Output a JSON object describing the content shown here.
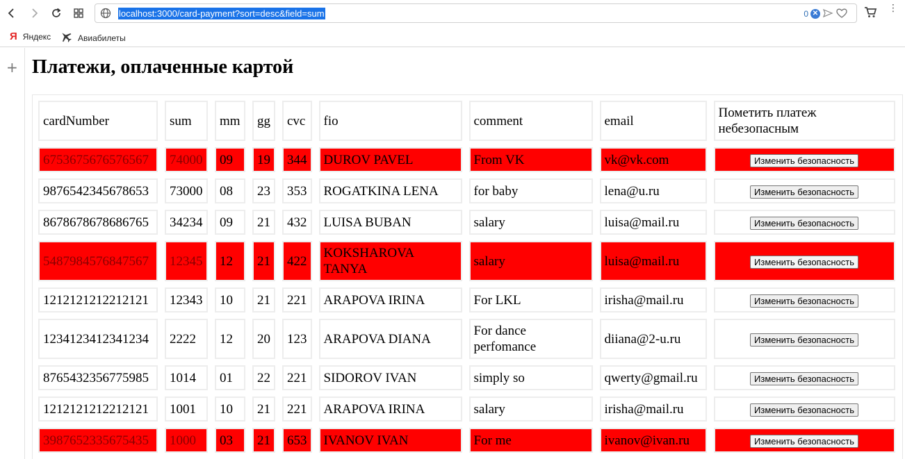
{
  "browser": {
    "url": "localhost:3000/card-payment?sort=desc&field=sum",
    "adblock_count": "0",
    "bookmarks": [
      {
        "label": "Яндекс"
      },
      {
        "label": "Авиабилеты"
      }
    ]
  },
  "page": {
    "title": "Платежи, оплаченные картой"
  },
  "table": {
    "headers": [
      "cardNumber",
      "sum",
      "mm",
      "gg",
      "cvc",
      "fio",
      "comment",
      "email",
      "Пометить платеж небезопасным"
    ],
    "button_label": "Изменить безопасность",
    "rows": [
      {
        "cardNumber": "6753675676576567",
        "sum": "74000",
        "mm": "09",
        "gg": "19",
        "cvc": "344",
        "fio": "DUROV PAVEL",
        "comment": "From VK",
        "email": "vk@vk.com",
        "unsafe": true
      },
      {
        "cardNumber": "9876542345678653",
        "sum": "73000",
        "mm": "08",
        "gg": "23",
        "cvc": "353",
        "fio": "ROGATKINA LENA",
        "comment": "for baby",
        "email": "lena@u.ru",
        "unsafe": false
      },
      {
        "cardNumber": "8678678678686765",
        "sum": "34234",
        "mm": "09",
        "gg": "21",
        "cvc": "432",
        "fio": "LUISA BUBAN",
        "comment": "salary",
        "email": "luisa@mail.ru",
        "unsafe": false
      },
      {
        "cardNumber": "5487984576847567",
        "sum": "12345",
        "mm": "12",
        "gg": "21",
        "cvc": "422",
        "fio": "KOKSHAROVA TANYA",
        "comment": "salary",
        "email": "luisa@mail.ru",
        "unsafe": true
      },
      {
        "cardNumber": "1212121212212121",
        "sum": "12343",
        "mm": "10",
        "gg": "21",
        "cvc": "221",
        "fio": "ARAPOVA IRINA",
        "comment": "For LKL",
        "email": "irisha@mail.ru",
        "unsafe": false
      },
      {
        "cardNumber": "1234123412341234",
        "sum": "2222",
        "mm": "12",
        "gg": "20",
        "cvc": "123",
        "fio": "ARAPOVA DIANA",
        "comment": "For dance perfomance",
        "email": "diiana@2-u.ru",
        "unsafe": false
      },
      {
        "cardNumber": "8765432356775985",
        "sum": "1014",
        "mm": "01",
        "gg": "22",
        "cvc": "221",
        "fio": "SIDOROV IVAN",
        "comment": "simply so",
        "email": "qwerty@gmail.ru",
        "unsafe": false
      },
      {
        "cardNumber": "1212121212212121",
        "sum": "1001",
        "mm": "10",
        "gg": "21",
        "cvc": "221",
        "fio": "ARAPOVA IRINA",
        "comment": "salary",
        "email": "irisha@mail.ru",
        "unsafe": false
      },
      {
        "cardNumber": "3987652335675435",
        "sum": "1000",
        "mm": "03",
        "gg": "21",
        "cvc": "653",
        "fio": "IVANOV IVAN",
        "comment": "For me",
        "email": "ivanov@ivan.ru",
        "unsafe": true
      }
    ]
  },
  "icons": {
    "back": "back-arrow-icon",
    "forward": "forward-arrow-icon",
    "reload": "reload-icon",
    "tabs": "tabs-grid-icon",
    "site": "globe-icon",
    "adblock": "adblock-icon",
    "share": "share-icon",
    "favorite": "heart-icon",
    "cart": "cart-icon",
    "menu": "menu-icon",
    "new_panel": "plus-icon"
  },
  "colors": {
    "unsafe_row": "#ff0000",
    "url_highlight": "#1a73e8",
    "yandex_red": "#e32222"
  }
}
